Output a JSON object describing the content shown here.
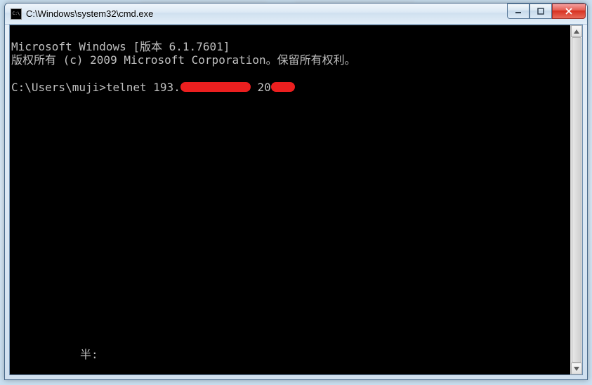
{
  "window": {
    "title": "C:\\Windows\\system32\\cmd.exe"
  },
  "terminal": {
    "line1": "Microsoft Windows [版本 6.1.7601]",
    "line2": "版权所有 (c) 2009 Microsoft Corporation。保留所有权利。",
    "prompt": "C:\\Users\\muji>",
    "cmd_prefix": "telnet 193",
    "cmd_mid": " 20",
    "ime_text": "半:"
  }
}
